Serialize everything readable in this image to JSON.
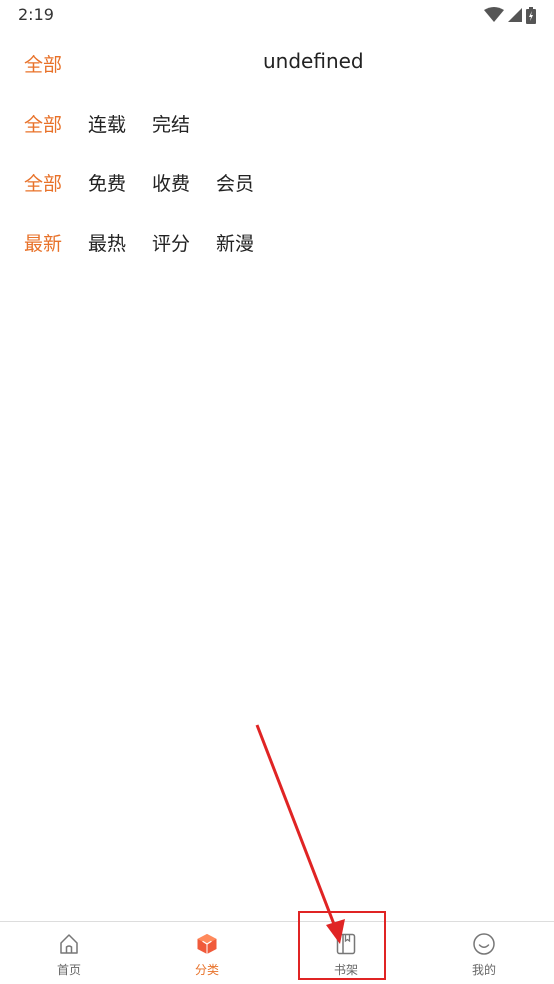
{
  "status_bar": {
    "time": "2:19"
  },
  "filters": {
    "row1": {
      "items": [
        "全部"
      ],
      "extra_text": "undefined"
    },
    "row2": {
      "items": [
        "全部",
        "连载",
        "完结"
      ]
    },
    "row3": {
      "items": [
        "全部",
        "免费",
        "收费",
        "会员"
      ]
    },
    "row4": {
      "items": [
        "最新",
        "最热",
        "评分",
        "新漫"
      ]
    }
  },
  "tab_bar": {
    "items": [
      {
        "label": "首页",
        "icon": "home-icon"
      },
      {
        "label": "分类",
        "icon": "category-cube-icon"
      },
      {
        "label": "书架",
        "icon": "bookshelf-icon"
      },
      {
        "label": "我的",
        "icon": "smile-profile-icon"
      }
    ],
    "active_index": 1
  },
  "colors": {
    "accent": "#e8722a",
    "text": "#222222",
    "tab_text": "#666666",
    "annotation": "#e02424"
  }
}
